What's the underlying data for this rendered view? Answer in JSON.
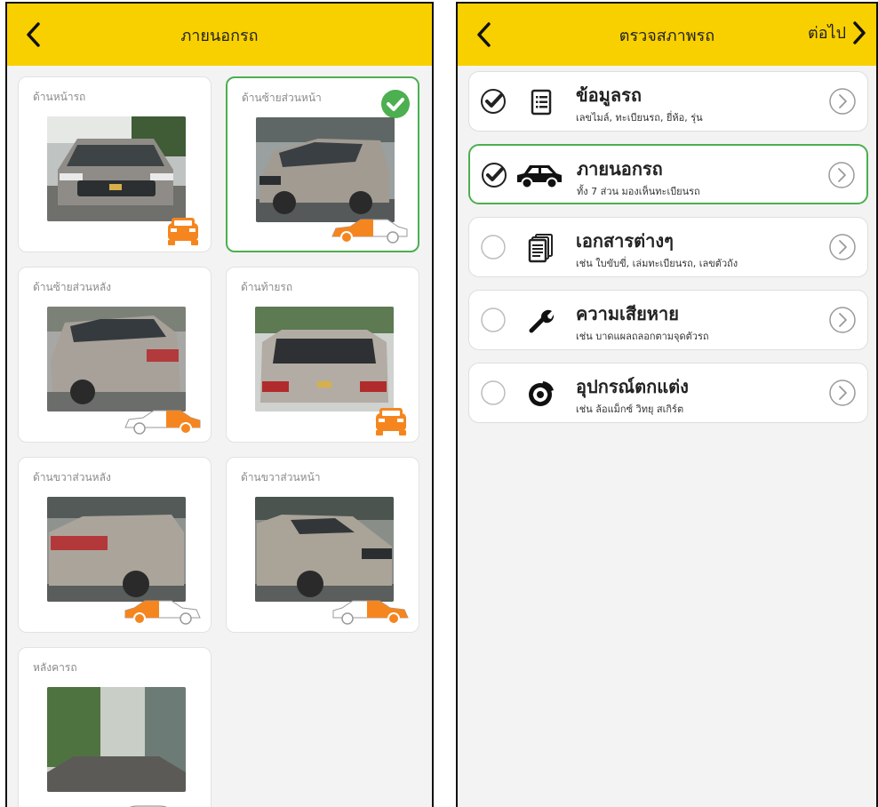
{
  "left_screen": {
    "title": "ภายนอกรถ",
    "photos": [
      {
        "label": "ด้านหน้ารถ",
        "selected": false
      },
      {
        "label": "ด้านซ้ายส่วนหน้า",
        "selected": true
      },
      {
        "label": "ด้านซ้ายส่วนหลัง",
        "selected": false
      },
      {
        "label": "ด้านท้ายรถ",
        "selected": false
      },
      {
        "label": "ด้านขวาส่วนหลัง",
        "selected": false
      },
      {
        "label": "ด้านขวาส่วนหน้า",
        "selected": false
      },
      {
        "label": "หลังคารถ",
        "selected": false
      }
    ]
  },
  "right_screen": {
    "title": "ตรวจสภาพรถ",
    "next_label": "ต่อไป",
    "items": [
      {
        "title": "ข้อมูลรถ",
        "subtitle": "เลขไมล์, ทะเบียนรถ, ยี่ห้อ, รุ่น",
        "done": true,
        "icon": "list-document-icon"
      },
      {
        "title": "ภายนอกรถ",
        "subtitle": "ทั้ง 7 ส่วน มองเห็นทะเบียนรถ",
        "done": true,
        "icon": "car-icon"
      },
      {
        "title": "เอกสารต่างๆ",
        "subtitle": "เช่น ใบขับขี่, เล่มทะเบียนรถ, เลขตัวถัง",
        "done": false,
        "icon": "documents-icon"
      },
      {
        "title": "ความเสียหาย",
        "subtitle": "เช่น บาดแผลถลอกตามจุดตัวรถ",
        "done": false,
        "icon": "wrench-icon"
      },
      {
        "title": "อุปกรณ์ตกแต่ง",
        "subtitle": "เช่น ล้อแม็กซ์ วิทยุ สเกิร์ต",
        "done": false,
        "icon": "brake-disc-icon"
      }
    ]
  },
  "colors": {
    "accent": "#f8d000",
    "success": "#4caf50",
    "highlight": "#f5861f",
    "background": "#f3f3f3"
  }
}
